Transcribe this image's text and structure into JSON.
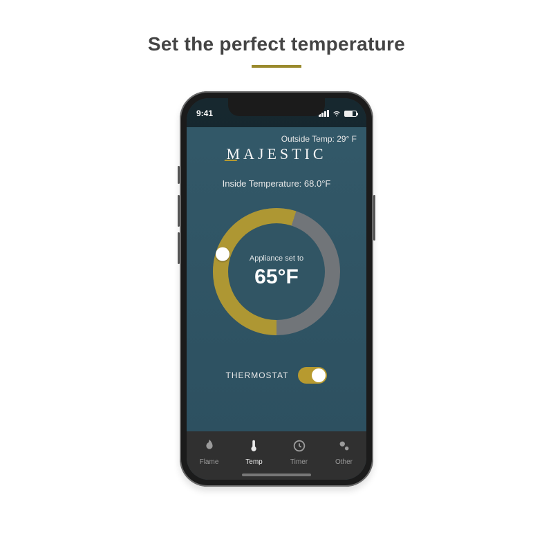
{
  "headline": "Set the perfect temperature",
  "statusbar": {
    "time": "9:41"
  },
  "header": {
    "outside_temp_label": "Outside Temp: 29° F",
    "brand": "MAJESTIC",
    "inside_temp_label": "Inside Temperature: 68.0°F"
  },
  "dial": {
    "set_label": "Appliance set to",
    "set_value": "65°F"
  },
  "thermostat": {
    "label": "THERMOSTAT",
    "on": true
  },
  "tabs": {
    "flame": "Flame",
    "temp": "Temp",
    "timer": "Timer",
    "other": "Other"
  },
  "colors": {
    "accent": "#b79a2f",
    "background": "#315564",
    "track": "#717579"
  }
}
